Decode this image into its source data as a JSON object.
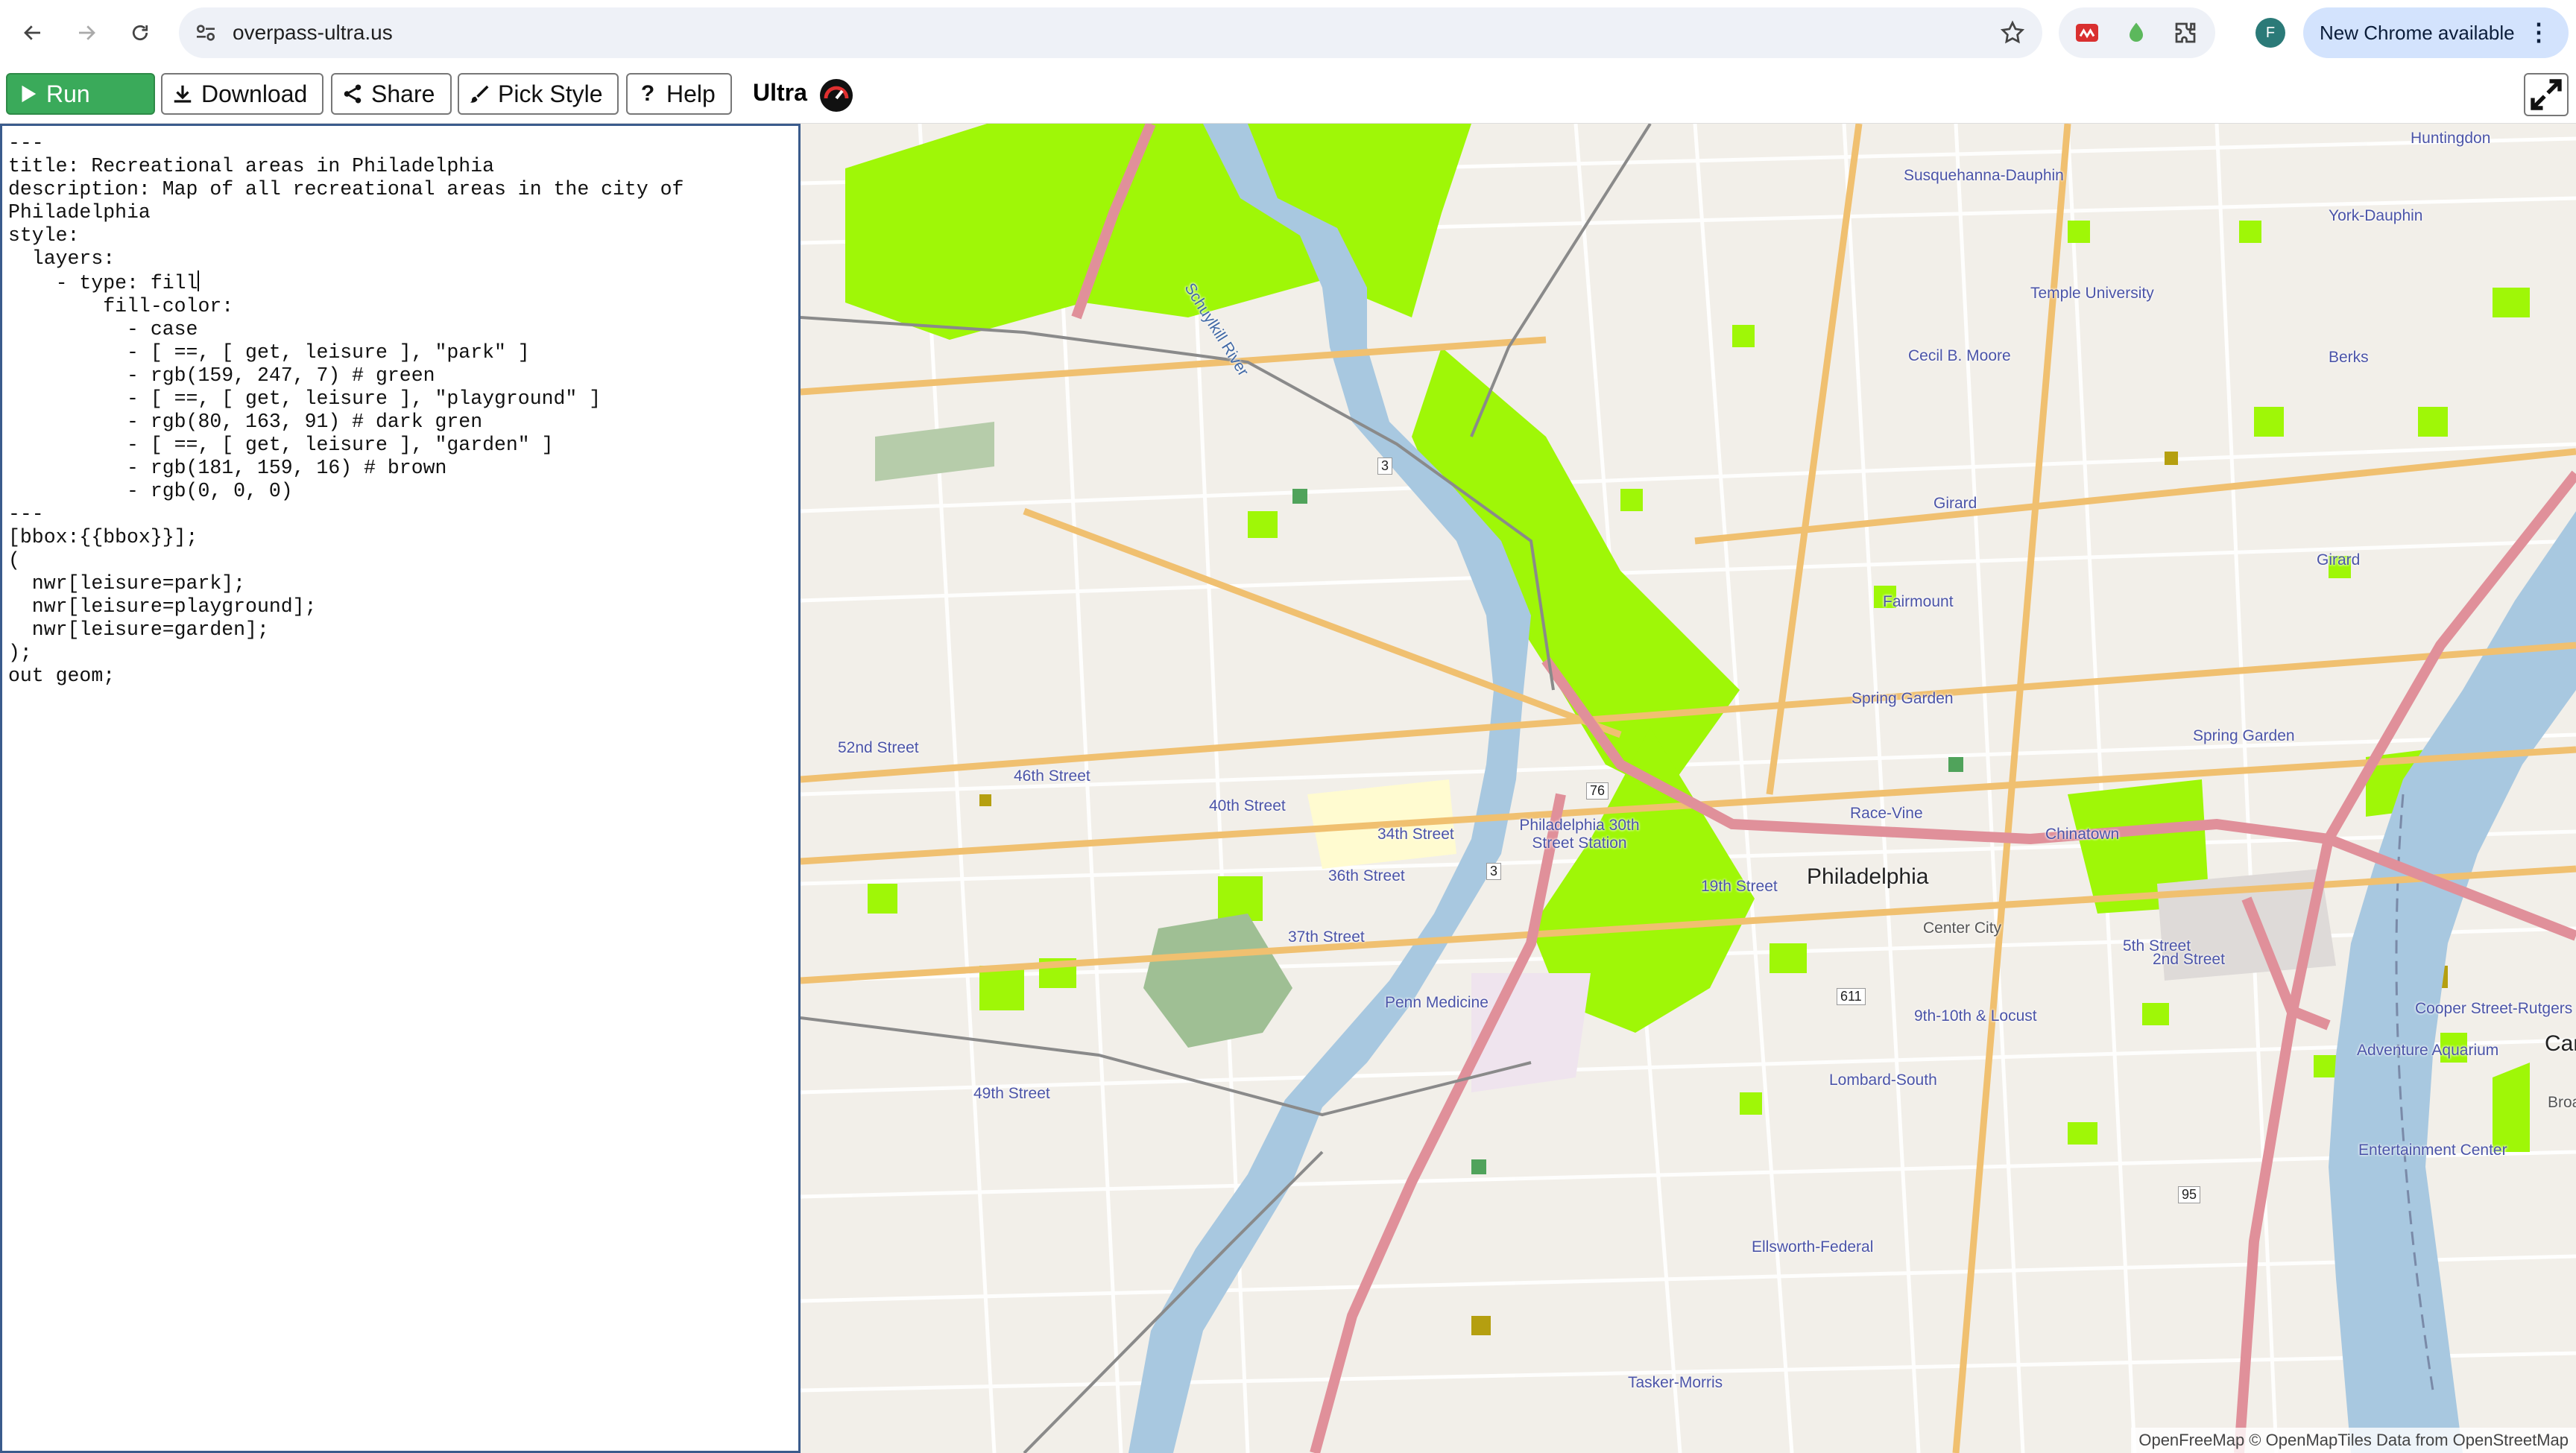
{
  "browser": {
    "url": "overpass-ultra.us",
    "profile_initial": "F",
    "update_label": "New Chrome available",
    "menu_glyph": "⋮"
  },
  "toolbar": {
    "run_label": "Run",
    "download_label": "Download",
    "share_label": "Share",
    "pick_style_label": "Pick Style",
    "help_label": "Help",
    "brand": "Ultra"
  },
  "editor": {
    "lines": [
      "---",
      "title: Recreational areas in Philadelphia",
      "description: Map of all recreational areas in the city of",
      "Philadelphia",
      "style:",
      "  layers:",
      "    - type: fill",
      "        fill-color:",
      "          - case",
      "          - [ ==, [ get, leisure ], \"park\" ]",
      "          - rgb(159, 247, 7) # green",
      "          - [ ==, [ get, leisure ], \"playground\" ]",
      "          - rgb(80, 163, 91) # dark gren",
      "          - [ ==, [ get, leisure ], \"garden\" ]",
      "          - rgb(181, 159, 16) # brown",
      "          - rgb(0, 0, 0)",
      "---",
      "[bbox:{{bbox}}];",
      "(",
      "  nwr[leisure=park];",
      "  nwr[leisure=playground];",
      "  nwr[leisure=garden];",
      ");",
      "out geom;"
    ]
  },
  "map": {
    "colors": {
      "park": "#9ff707",
      "playground": "#50a35b",
      "garden": "#b59f10",
      "water": "#a8c8e0",
      "motorway": "#e0909a",
      "primary": "#f0c070"
    },
    "labels": {
      "huntingdon": "Huntingdon",
      "susquehanna": "Susquehanna-Dauphin",
      "york": "York-Dauphin",
      "temple": "Temple University",
      "cecil": "Cecil B. Moore",
      "berks": "Berks",
      "girard1": "Girard",
      "girard2": "Girard",
      "fairmount": "Fairmount",
      "spring_garden1": "Spring Garden",
      "spring_garden2": "Spring Garden",
      "street52": "52nd Street",
      "street46": "46th Street",
      "street40": "40th Street",
      "street34": "34th Street",
      "street36": "36th Street",
      "street37": "37th Street",
      "street30": "Philadelphia 30th Street Station",
      "race_vine": "Race-Vine",
      "chinatown": "Chinatown",
      "street19": "19th Street",
      "philadelphia": "Philadelphia",
      "center_city": "Center City",
      "street5": "5th Street",
      "street2": "2nd Street",
      "cooper": "Cooper Street-Rutgers",
      "aquarium": "Adventure Aquarium",
      "cam": "Cam",
      "broa": "Broa",
      "entertainment": "Entertainment Center",
      "locust": "9th-10th & Locust",
      "lombard": "Lombard-South",
      "penn": "Penn Medicine",
      "street49": "49th Street",
      "ellsworth": "Ellsworth-Federal",
      "tasker": "Tasker-Morris",
      "river": "Schuylkill River",
      "shield76": "76",
      "shield3a": "3",
      "shield3b": "3",
      "shield611": "611",
      "shield95": "95"
    },
    "attribution": "OpenFreeMap © OpenMapTiles Data from OpenStreetMap"
  }
}
